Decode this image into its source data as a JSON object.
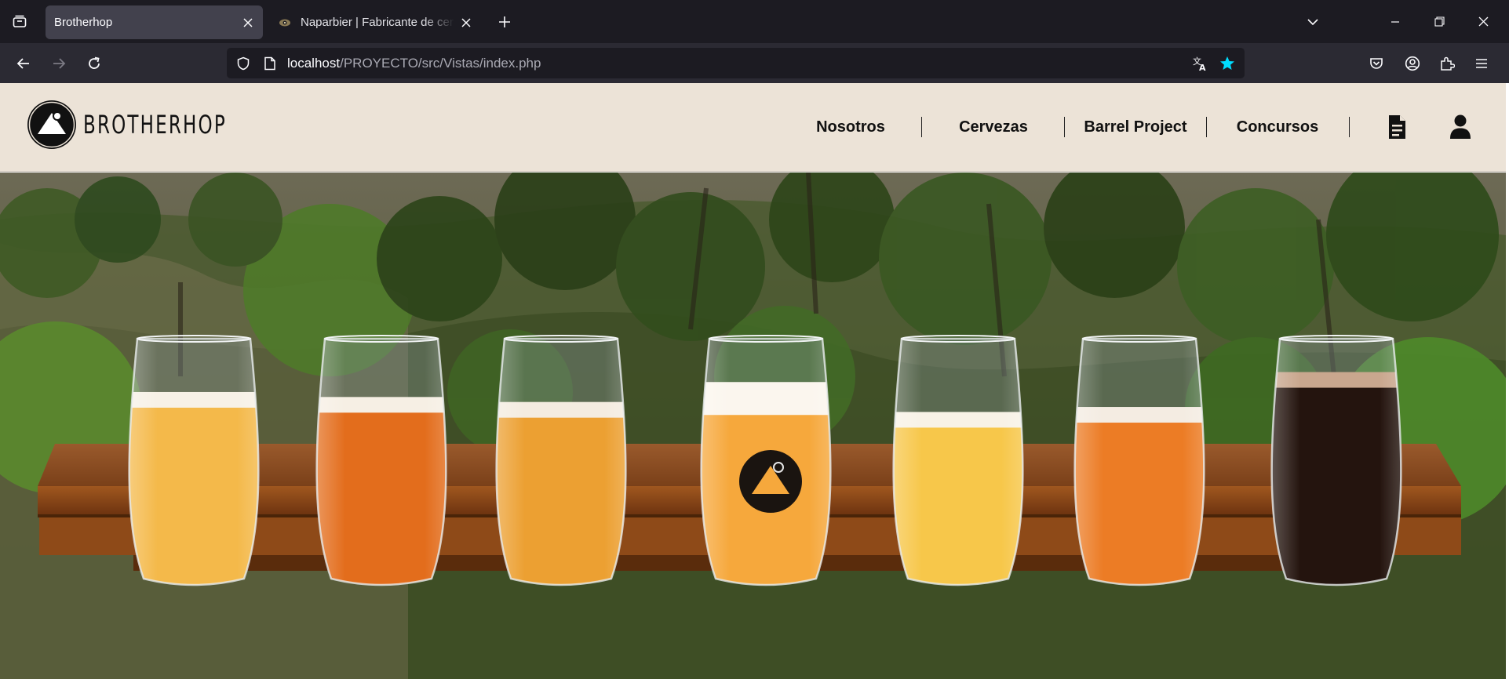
{
  "browser": {
    "tabs": [
      {
        "title": "Brotherhop",
        "active": true
      },
      {
        "title": "Naparbier | Fabricante de cerveza",
        "active": false
      }
    ],
    "url": {
      "host": "localhost",
      "path": "/PROYECTO/src/Vistas/index.php"
    }
  },
  "site": {
    "logo_text": "BROTHERHOP",
    "nav": [
      {
        "label": "Nosotros"
      },
      {
        "label": "Cervezas"
      },
      {
        "label": "Barrel Project"
      },
      {
        "label": "Concursos"
      }
    ],
    "icons": [
      "document-icon",
      "user-icon"
    ]
  },
  "hero": {
    "glasses": [
      {
        "beer": "#f4b94a",
        "head": "#f7f1e6",
        "fill": 0.78
      },
      {
        "beer": "#e36d1c",
        "head": "#f6efe4",
        "fill": 0.76
      },
      {
        "beer": "#eca032",
        "head": "#f4ece0",
        "fill": 0.74
      },
      {
        "beer": "#f6a83c",
        "head": "#fbf6ee",
        "fill": 0.82
      },
      {
        "beer": "#f7c74a",
        "head": "#f8f2e6",
        "fill": 0.7
      },
      {
        "beer": "#ec7c25",
        "head": "#f4ece2",
        "fill": 0.72
      },
      {
        "beer": "#24140e",
        "head": "#c9a78e",
        "fill": 0.86
      }
    ]
  },
  "colors": {
    "header_bg": "#ece3d7",
    "tabbar_bg": "#1c1b22",
    "toolbar_bg": "#2b2a33",
    "bookmark_star": "#00ddff"
  }
}
